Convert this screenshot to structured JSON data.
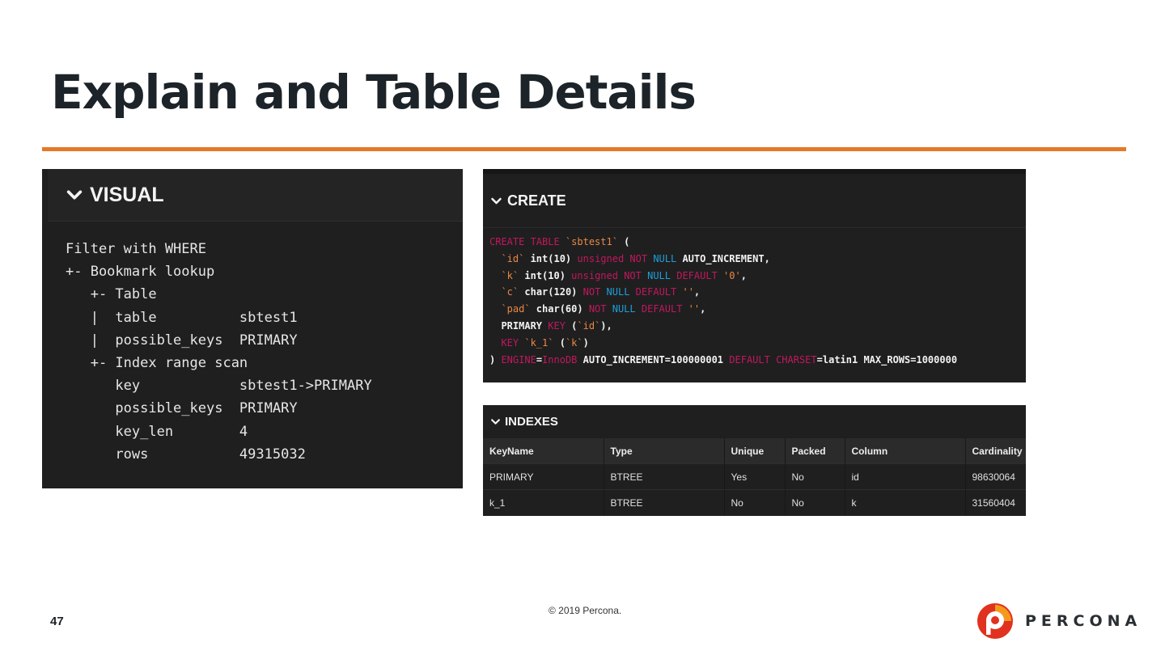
{
  "slide": {
    "title": "Explain and Table Details",
    "page_number": "47",
    "copyright": "© 2019 Percona.",
    "brand": "PERCONA",
    "accent_color": "#e57928"
  },
  "visual": {
    "header": "VISUAL",
    "plan_text": "Filter with WHERE\n+- Bookmark lookup\n   +- Table\n   |  table          sbtest1\n   |  possible_keys  PRIMARY\n   +- Index range scan\n      key            sbtest1->PRIMARY\n      possible_keys  PRIMARY\n      key_len        4\n      rows           49315032"
  },
  "create": {
    "header": "CREATE",
    "table_name": "`sbtest1`",
    "col_id": "`id`",
    "col_k": "`k`",
    "col_c": "`c`",
    "col_pad": "`pad`",
    "key_name": "`k_1`",
    "engine_value": "InnoDB",
    "auto_increment": "AUTO_INCREMENT=100000001",
    "charset_value": "=latin1",
    "max_rows": "MAX_ROWS=1000000"
  },
  "indexes": {
    "header": "INDEXES",
    "columns": [
      "KeyName",
      "Type",
      "Unique",
      "Packed",
      "Column",
      "Cardinality"
    ],
    "rows": [
      [
        "PRIMARY",
        "BTREE",
        "Yes",
        "No",
        "id",
        "98630064"
      ],
      [
        "k_1",
        "BTREE",
        "No",
        "No",
        "k",
        "31560404"
      ]
    ]
  },
  "icons": [
    "chevron-down-icon",
    "percona-logo-icon"
  ]
}
